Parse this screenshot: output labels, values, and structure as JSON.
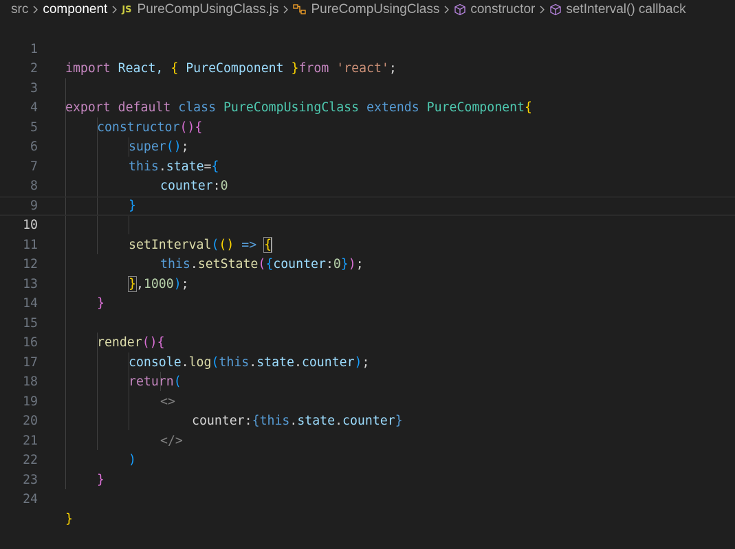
{
  "breadcrumb": {
    "src": "src",
    "component": "component",
    "js_badge": "JS",
    "file": "PureCompUsingClass.js",
    "class_symbol": "PureCompUsingClass",
    "constructor_symbol": "constructor",
    "callback_symbol": "setInterval() callback"
  },
  "editor": {
    "current_line": 10,
    "line_numbers": [
      "1",
      "2",
      "3",
      "4",
      "5",
      "6",
      "7",
      "8",
      "9",
      "10",
      "11",
      "12",
      "13",
      "14",
      "15",
      "16",
      "17",
      "18",
      "19",
      "20",
      "21",
      "22",
      "23",
      "24"
    ],
    "tokens": {
      "l1": [
        "import",
        " React, ",
        "{",
        " PureComponent ",
        "}",
        "from",
        " ",
        "'react'",
        ";"
      ],
      "l3": [
        "export",
        " ",
        "default",
        " ",
        "class",
        " ",
        "PureCompUsingClass",
        " ",
        "extends",
        " ",
        "PureComponent",
        "{"
      ],
      "l4": [
        "constructor",
        "(",
        ")",
        "{"
      ],
      "l5": [
        "super",
        "(",
        ")",
        ";"
      ],
      "l6": [
        "this",
        ".",
        "state",
        "=",
        "{"
      ],
      "l7": [
        "counter",
        ":",
        "0"
      ],
      "l8": [
        "}"
      ],
      "l10": [
        "setInterval",
        "(",
        "()",
        " ",
        "=>",
        " ",
        "{"
      ],
      "l11": [
        "this",
        ".",
        "setState",
        "(",
        "{",
        "counter",
        ":",
        "0",
        "}",
        ")",
        ";"
      ],
      "l12": [
        "}",
        ",",
        "1000",
        ")",
        ";"
      ],
      "l13": [
        "}"
      ],
      "l15": [
        "render",
        "(",
        ")",
        "{"
      ],
      "l16": [
        "console",
        ".",
        "log",
        "(",
        "this",
        ".",
        "state",
        ".",
        "counter",
        ")",
        ";"
      ],
      "l17": [
        "return",
        "("
      ],
      "l18": [
        "<>"
      ],
      "l19": [
        "counter:",
        "{",
        "this",
        ".",
        "state",
        ".",
        "counter",
        "}"
      ],
      "l20": [
        "</>"
      ],
      "l21": [
        ")"
      ],
      "l22": [
        "}"
      ],
      "l24": [
        "}"
      ]
    }
  },
  "colors": {
    "background": "#1f1f1f",
    "keyword": "#c586c0",
    "storage": "#569cd6",
    "class_name": "#4ec9b0",
    "variable": "#9cdcfe",
    "function": "#dcdcaa",
    "string": "#ce9178",
    "number": "#b5cea8"
  }
}
